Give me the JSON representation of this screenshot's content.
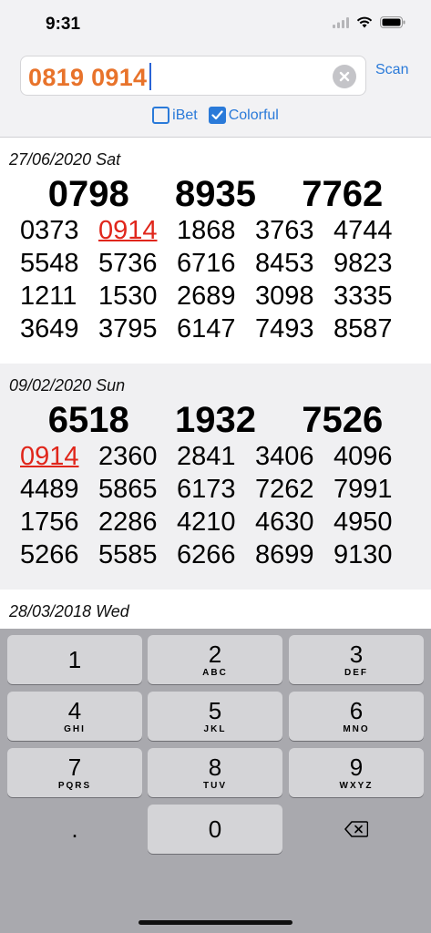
{
  "status": {
    "time": "9:31"
  },
  "search": {
    "value": "0819 0914",
    "scan_label": "Scan"
  },
  "options": [
    {
      "label": "iBet",
      "checked": false
    },
    {
      "label": "Colorful",
      "checked": true
    }
  ],
  "records": [
    {
      "date": "27/06/2020 Sat",
      "top": "0798  8935  7762",
      "numbers": [
        "0373",
        "0914",
        "1868",
        "3763",
        "4744",
        "5548",
        "5736",
        "6716",
        "8453",
        "9823",
        "1211",
        "1530",
        "2689",
        "3098",
        "3335",
        "3649",
        "3795",
        "6147",
        "7493",
        "8587"
      ],
      "highlight": [
        "0914"
      ]
    },
    {
      "date": "09/02/2020 Sun",
      "top": "6518  1932  7526",
      "numbers": [
        "0914",
        "2360",
        "2841",
        "3406",
        "4096",
        "4489",
        "5865",
        "6173",
        "7262",
        "7991",
        "1756",
        "2286",
        "4210",
        "4630",
        "4950",
        "5266",
        "5585",
        "6266",
        "8699",
        "9130"
      ],
      "highlight": [
        "0914"
      ]
    },
    {
      "date": "28/03/2018 Wed",
      "top": "",
      "numbers": [],
      "highlight": []
    }
  ],
  "keyboard": {
    "keys": [
      {
        "digit": "1",
        "letters": ""
      },
      {
        "digit": "2",
        "letters": "ABC"
      },
      {
        "digit": "3",
        "letters": "DEF"
      },
      {
        "digit": "4",
        "letters": "GHI"
      },
      {
        "digit": "5",
        "letters": "JKL"
      },
      {
        "digit": "6",
        "letters": "MNO"
      },
      {
        "digit": "7",
        "letters": "PQRS"
      },
      {
        "digit": "8",
        "letters": "TUV"
      },
      {
        "digit": "9",
        "letters": "WXYZ"
      },
      {
        "digit": ".",
        "letters": ""
      },
      {
        "digit": "0",
        "letters": ""
      },
      {
        "digit": "",
        "letters": "",
        "icon": "backspace-icon"
      }
    ]
  },
  "colors": {
    "accent": "#2a7ad9",
    "search_text": "#e8732b",
    "hit": "#e0261b"
  }
}
